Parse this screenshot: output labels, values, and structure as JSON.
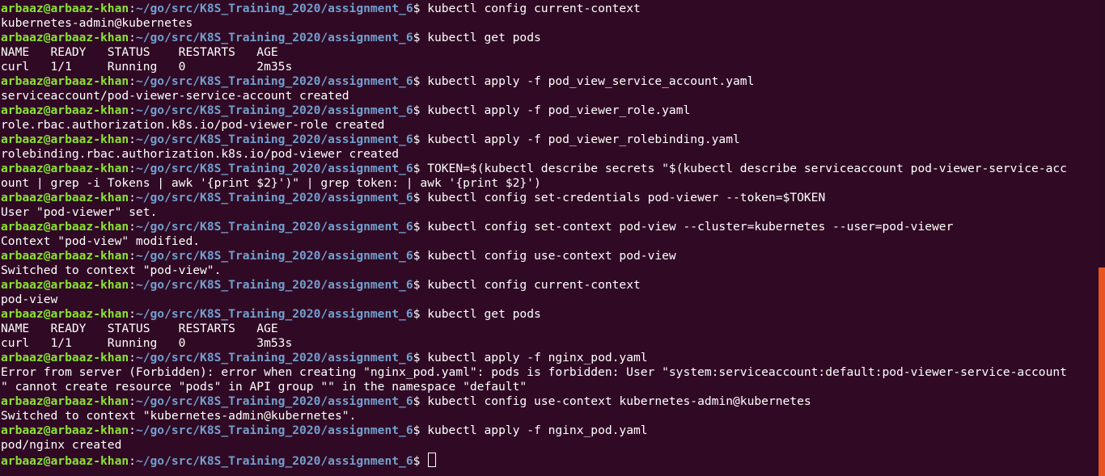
{
  "terminal": {
    "prompt": {
      "user_host": "arbaaz@arbaaz-khan",
      "colon": ":",
      "path": "~/go/src/K8S_Training_2020/assignment_6",
      "dollar": "$ "
    },
    "lines": [
      {
        "type": "cmd",
        "text": "kubectl config current-context"
      },
      {
        "type": "out",
        "text": "kubernetes-admin@kubernetes"
      },
      {
        "type": "cmd",
        "text": "kubectl get pods"
      },
      {
        "type": "out",
        "text": "NAME   READY   STATUS    RESTARTS   AGE"
      },
      {
        "type": "out",
        "text": "curl   1/1     Running   0          2m35s"
      },
      {
        "type": "cmd",
        "text": "kubectl apply -f pod_view_service_account.yaml"
      },
      {
        "type": "out",
        "text": "serviceaccount/pod-viewer-service-account created"
      },
      {
        "type": "cmd",
        "text": "kubectl apply -f pod_viewer_role.yaml"
      },
      {
        "type": "out",
        "text": "role.rbac.authorization.k8s.io/pod-viewer-role created"
      },
      {
        "type": "cmd",
        "text": "kubectl apply -f pod_viewer_rolebinding.yaml"
      },
      {
        "type": "out",
        "text": "rolebinding.rbac.authorization.k8s.io/pod-viewer created"
      },
      {
        "type": "cmd",
        "text": "TOKEN=$(kubectl describe secrets \"$(kubectl describe serviceaccount pod-viewer-service-acc"
      },
      {
        "type": "out",
        "text": "ount | grep -i Tokens | awk '{print $2}')\" | grep token: | awk '{print $2}')"
      },
      {
        "type": "cmd",
        "text": "kubectl config set-credentials pod-viewer --token=$TOKEN"
      },
      {
        "type": "out",
        "text": "User \"pod-viewer\" set."
      },
      {
        "type": "cmd",
        "text": "kubectl config set-context pod-view --cluster=kubernetes --user=pod-viewer"
      },
      {
        "type": "out",
        "text": "Context \"pod-view\" modified."
      },
      {
        "type": "cmd",
        "text": "kubectl config use-context pod-view"
      },
      {
        "type": "out",
        "text": "Switched to context \"pod-view\"."
      },
      {
        "type": "cmd",
        "text": "kubectl config current-context"
      },
      {
        "type": "out",
        "text": "pod-view"
      },
      {
        "type": "cmd",
        "text": "kubectl get pods"
      },
      {
        "type": "out",
        "text": "NAME   READY   STATUS    RESTARTS   AGE"
      },
      {
        "type": "out",
        "text": "curl   1/1     Running   0          3m53s"
      },
      {
        "type": "cmd",
        "text": "kubectl apply -f nginx_pod.yaml"
      },
      {
        "type": "out",
        "text": "Error from server (Forbidden): error when creating \"nginx_pod.yaml\": pods is forbidden: User \"system:serviceaccount:default:pod-viewer-service-account"
      },
      {
        "type": "out",
        "text": "\" cannot create resource \"pods\" in API group \"\" in the namespace \"default\""
      },
      {
        "type": "cmd",
        "text": "kubectl config use-context kubernetes-admin@kubernetes"
      },
      {
        "type": "out",
        "text": "Switched to context \"kubernetes-admin@kubernetes\"."
      },
      {
        "type": "cmd",
        "text": "kubectl apply -f nginx_pod.yaml"
      },
      {
        "type": "out",
        "text": "pod/nginx created"
      },
      {
        "type": "prompt",
        "text": ""
      }
    ],
    "colors": {
      "background": "#300a24",
      "user_host": "#8ae234",
      "path": "#729fcf",
      "text": "#ffffff",
      "scrollbar_thumb": "#e95420"
    }
  }
}
